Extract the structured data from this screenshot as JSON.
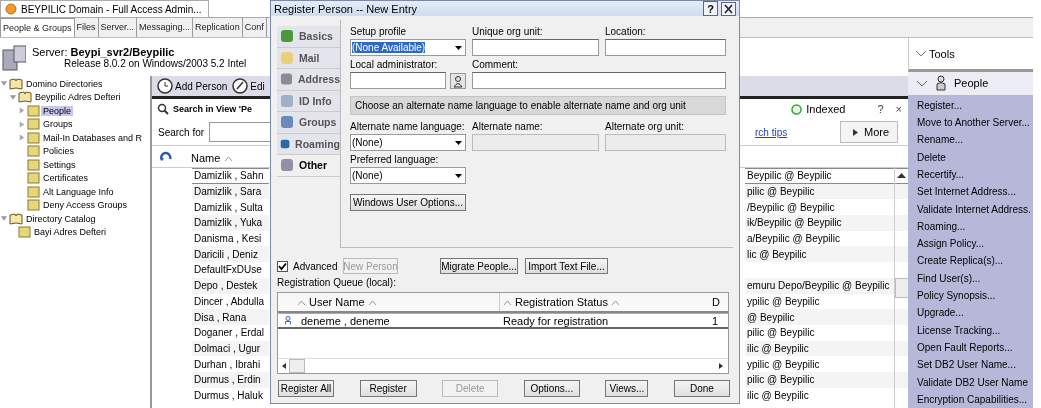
{
  "app_tab": {
    "title": "BEYPILIC Domain - Full Access Admin..."
  },
  "tabs": [
    {
      "label": "People & Groups",
      "selected": true
    },
    {
      "label": "Files",
      "selected": false
    },
    {
      "label": "Server...",
      "selected": false
    },
    {
      "label": "Messaging...",
      "selected": false
    },
    {
      "label": "Replication",
      "selected": false
    },
    {
      "label": "Conf",
      "selected": false
    }
  ],
  "server": {
    "label": "Server:",
    "name": "Beypi_svr2/Beypilic",
    "release": "Release 8.0.2 on Windows/2003 5.2 Intel"
  },
  "tree": [
    {
      "label": "Domino Directories",
      "expanded": true,
      "selected": false,
      "children": [
        {
          "label": "Beypilic Adres Defteri",
          "expanded": true,
          "selected": false,
          "children": [
            {
              "label": "People",
              "expanded": false,
              "selected": true
            },
            {
              "label": "Groups",
              "expanded": false,
              "selected": false
            },
            {
              "label": "Mail-In Databases and R",
              "expanded": false,
              "selected": false
            },
            {
              "label": "Policies",
              "selected": false
            },
            {
              "label": "Settings",
              "selected": false
            },
            {
              "label": "Certificates",
              "selected": false
            },
            {
              "label": "Alt Language Info",
              "selected": false
            },
            {
              "label": "Deny Access Groups",
              "selected": false
            }
          ]
        }
      ]
    },
    {
      "label": "Directory Catalog",
      "expanded": true,
      "selected": false,
      "children": [
        {
          "label": "Bayi Adres Defteri",
          "selected": false
        }
      ]
    }
  ],
  "toolbar": {
    "buttons": [
      "Add Person",
      "Edi"
    ]
  },
  "search": {
    "title": "Search in View 'Pe",
    "status": "Indexed",
    "help": "?",
    "close": "×",
    "label": "Search for",
    "tips_link": "rch tips",
    "more_button": "More"
  },
  "view": {
    "columns": [
      "Name"
    ],
    "rows": [
      {
        "name": "Damizlik , Sahn",
        "column_2": "Beypilic @ Beypilic",
        "selected": true
      },
      {
        "name": "Damizlik , Sara",
        "column_2": "pilic @ Beypilic",
        "selected": false
      },
      {
        "name": "Damizlik , Sulta",
        "column_2": "/Beypilic @ Beypilic",
        "selected": false
      },
      {
        "name": "Damizlik , Yuka",
        "column_2": "ik/Beypilic @ Beypilic",
        "selected": false
      },
      {
        "name": "Danisma , Kesi",
        "column_2": "a/Beypilic @ Beypilic",
        "selected": false
      },
      {
        "name": "Daricili , Deniz",
        "column_2": "lic @ Beypilic",
        "selected": false
      },
      {
        "name": "DefaultFxDUse",
        "selected": false
      },
      {
        "name": "Depo , Destek",
        "column_2": "emuru Depo/Beypilic @ Beypilic",
        "selected": false
      },
      {
        "name": "Dincer , Abdulla",
        "column_2": "ypilic @ Beypilic",
        "selected": false
      },
      {
        "name": "Disa , Rana",
        "column_2": "@ Beypilic",
        "selected": false
      },
      {
        "name": "Doganer , Erdal",
        "column_2": "pilic @ Beypilic",
        "selected": false
      },
      {
        "name": "Dolmaci , Ugur",
        "column_2": "ilic @ Beypilic",
        "selected": false
      },
      {
        "name": "Durhan , Ibrahi",
        "column_2": "ypilic @ Beypilic",
        "selected": false
      },
      {
        "name": "Durmus , Erdin",
        "column_2": "pilic @ Beypilic",
        "selected": false
      },
      {
        "name": "Durmus , Haluk",
        "column_2": "ilic @ Beypilic",
        "selected": false
      }
    ]
  },
  "tools": {
    "title": "Tools",
    "section": "People",
    "items": [
      "Register...",
      "Move to Another Server...",
      "Rename...",
      "Delete",
      "Recertify...",
      "Set Internet Address...",
      "Validate Internet Address.",
      "Roaming...",
      "Assign Policy...",
      "Create Replica(s)...",
      "Find User(s)...",
      "Policy Synopsis...",
      "Upgrade...",
      "License Tracking...",
      "Open Fault Reports...",
      "Set DB2 User Name...",
      "Validate DB2 User Name",
      "Encryption Capabilities..."
    ]
  },
  "dialog": {
    "title": "Register Person -- New Entry",
    "help": "?",
    "nav": [
      {
        "label": "Basics",
        "selected": false
      },
      {
        "label": "Mail",
        "selected": false
      },
      {
        "label": "Address",
        "selected": false
      },
      {
        "label": "ID Info",
        "selected": false
      },
      {
        "label": "Groups",
        "selected": false
      },
      {
        "label": "Roaming",
        "selected": false
      },
      {
        "label": "Other",
        "selected": true
      }
    ],
    "setup_profile": {
      "label": "Setup profile",
      "value": "(None Available)"
    },
    "unique_org_unit": {
      "label": "Unique org unit:"
    },
    "location": {
      "label": "Location:"
    },
    "local_administrator": {
      "label": "Local administrator:"
    },
    "comment": {
      "label": "Comment:"
    },
    "banner": "Choose an alternate name language to enable alternate name and org unit",
    "alternate_name_language": {
      "label": "Alternate name language:",
      "value": "(None)"
    },
    "alternate_name": {
      "label": "Alternate name:",
      "disabled": true
    },
    "alternate_org_unit": {
      "label": "Alternate org unit:",
      "disabled": true
    },
    "preferred_language": {
      "label": "Preferred language:",
      "value": "(None)"
    },
    "windows_button": "Windows User Options...",
    "advanced": {
      "label": "Advanced",
      "checked": true
    },
    "actions": [
      {
        "label": "New Person",
        "disabled": true
      },
      {
        "label": "Migrate People...",
        "disabled": false
      },
      {
        "label": "Import Text File...",
        "disabled": false
      }
    ],
    "queue_label": "Registration Queue (local):",
    "queue": {
      "columns": [
        "User Name",
        "Registration Status",
        "D"
      ],
      "rows": [
        {
          "cells": [
            "deneme , deneme",
            "Ready for registration",
            "1"
          ],
          "selected": true
        }
      ]
    },
    "buttons": [
      {
        "label": "Register All",
        "disabled": false
      },
      {
        "label": "Register",
        "disabled": false
      },
      {
        "label": "Delete",
        "disabled": true
      },
      {
        "label": "Options...",
        "disabled": false
      },
      {
        "label": "Views...",
        "disabled": false
      },
      {
        "label": "Done",
        "disabled": false
      }
    ]
  }
}
